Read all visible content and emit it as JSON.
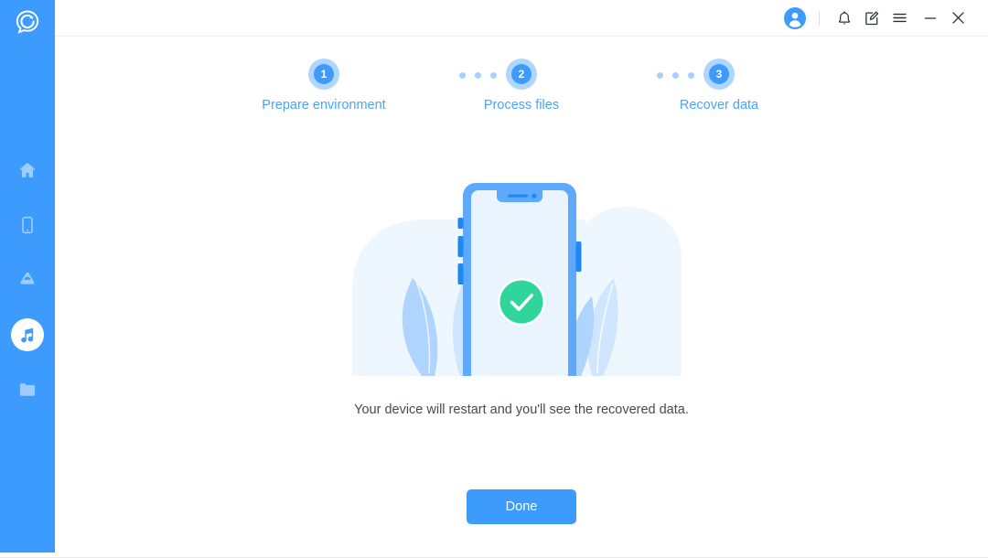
{
  "app": {
    "logo_icon": "chat-refresh-logo-icon",
    "accent_color": "#3D9BFE",
    "sidebar_color": "#3D9BFE",
    "success_color": "#2FD59A"
  },
  "sidebar": {
    "items": [
      {
        "icon": "home-icon",
        "name": "sidebar-item-home",
        "active": false
      },
      {
        "icon": "device-icon",
        "name": "sidebar-item-device",
        "active": false
      },
      {
        "icon": "cloud-icon",
        "name": "sidebar-item-cloud",
        "active": false
      },
      {
        "icon": "music-icon",
        "name": "sidebar-item-music",
        "active": true
      },
      {
        "icon": "folder-icon",
        "name": "sidebar-item-files",
        "active": false
      }
    ]
  },
  "titlebar": {
    "buttons": [
      {
        "icon": "account-avatar-icon",
        "name": "account-avatar"
      },
      {
        "icon": "bell-icon",
        "name": "notifications-button"
      },
      {
        "icon": "feedback-icon",
        "name": "feedback-button"
      },
      {
        "icon": "hamburger-menu-icon",
        "name": "menu-button"
      },
      {
        "icon": "minimize-icon",
        "name": "minimize-button"
      },
      {
        "icon": "close-icon",
        "name": "close-button"
      }
    ]
  },
  "stepper": {
    "steps": [
      {
        "number": "1",
        "label": "Prepare environment"
      },
      {
        "number": "2",
        "label": "Process files"
      },
      {
        "number": "3",
        "label": "Recover data"
      }
    ],
    "separator_dots": 3
  },
  "illustration": {
    "name": "phone-success-illustration",
    "status_icon": "green-check-circle-icon",
    "blob_color": "#EFF7FE",
    "phone_frame_color": "#5EA9FC",
    "phone_screen_color": "#EAF4FE",
    "button_color": "#1E88F5",
    "leaf_colors": [
      "#AFD4FD",
      "#CFE6FE"
    ]
  },
  "main": {
    "caption": "Your device will restart and you'll see the recovered data.",
    "done_label": "Done"
  }
}
